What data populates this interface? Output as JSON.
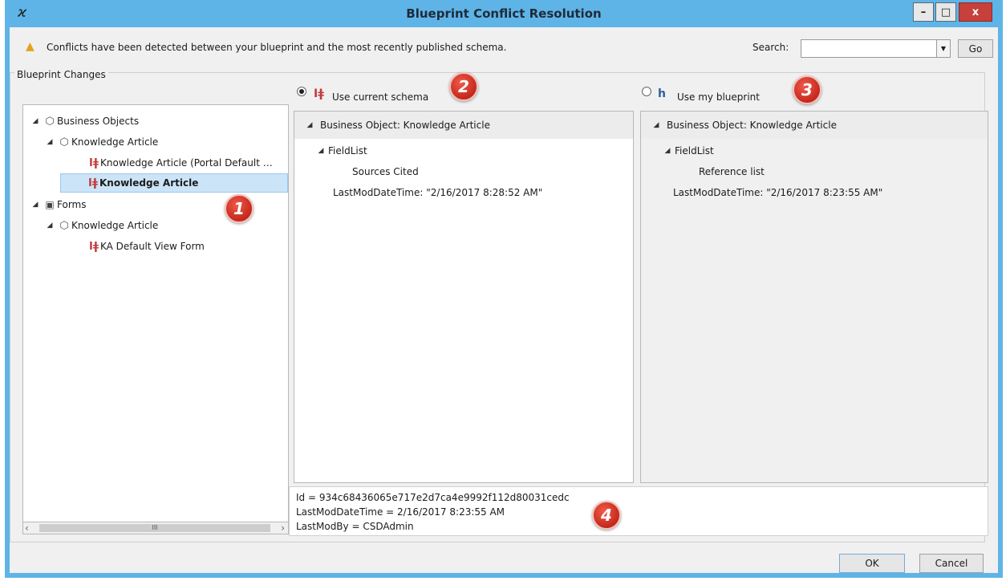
{
  "window": {
    "title": "Blueprint Conflict Resolution",
    "app_icon": "blueprint-app-icon",
    "minimize_label": "–",
    "maximize_label": "□",
    "close_label": "x"
  },
  "warning": {
    "icon": "warning-icon",
    "text": "Conflicts have been detected between your blueprint and the most recently published schema."
  },
  "search": {
    "label": "Search:",
    "value": "",
    "go_label": "Go"
  },
  "group_label": "Blueprint Changes",
  "tree": {
    "items": [
      {
        "label": "Business Objects",
        "icon": "cube-icon"
      },
      {
        "label": "Knowledge Article",
        "icon": "cube-icon"
      },
      {
        "label": "Knowledge Article (Portal Default …",
        "icon": "conflict-icon"
      },
      {
        "label": "Knowledge Article",
        "icon": "conflict-icon",
        "selected": true
      },
      {
        "label": "Forms",
        "icon": "form-icon"
      },
      {
        "label": "Knowledge Article",
        "icon": "cube-icon"
      },
      {
        "label": "KA Default View Form",
        "icon": "conflict-icon"
      }
    ],
    "scroll_thumb_label": "III"
  },
  "options": {
    "current_schema_label": "Use current schema",
    "my_blueprint_label": "Use my blueprint",
    "selected": "current_schema"
  },
  "badges": [
    "1",
    "2",
    "3",
    "4"
  ],
  "left_panel": {
    "header": "Business Object: Knowledge Article",
    "field_list": "FieldList",
    "field": "Sources Cited",
    "last_mod": "LastModDateTime: \"2/16/2017 8:28:52 AM\""
  },
  "right_panel": {
    "header": "Business Object: Knowledge Article",
    "field_list": "FieldList",
    "field": "Reference list",
    "last_mod": "LastModDateTime: \"2/16/2017 8:23:55 AM\""
  },
  "info": {
    "line1": "Id = 934c68436065e717e2d7ca4e9992f112d80031cedc",
    "line2": "LastModDateTime = 2/16/2017 8:23:55 AM",
    "line3": "LastModBy = CSDAdmin"
  },
  "buttons": {
    "ok": "OK",
    "cancel": "Cancel"
  },
  "colors": {
    "titlebar": "#5eb4e6",
    "selection": "#cce4f7",
    "badge": "#d9362a",
    "conflict_icon": "#c23b3b"
  }
}
